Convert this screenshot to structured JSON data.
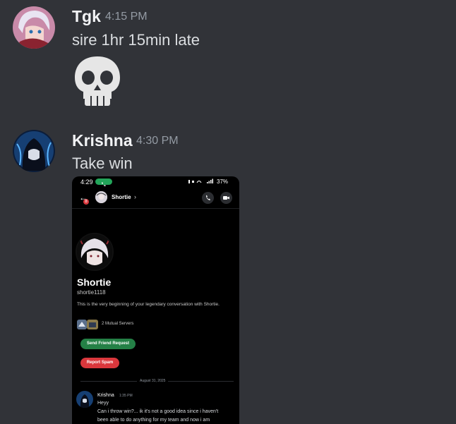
{
  "messages": [
    {
      "author": "Tgk",
      "timestamp": "4:15 PM",
      "lines": [
        "sire 1hr 15min late"
      ],
      "emoji": "💀"
    },
    {
      "author": "Krishna",
      "timestamp": "4:30 PM",
      "lines": [
        "Take win"
      ],
      "attachment": {
        "status_bar": {
          "time": "4:29",
          "battery": "37%"
        },
        "header": {
          "name": "Shortie",
          "notification_count": "8"
        },
        "profile": {
          "display_name": "Shortie",
          "username": "shortie1118",
          "description": "This is the very beginning of your legendary conversation with Shortie.",
          "mutual_servers": "2 Mutual Servers"
        },
        "buttons": {
          "friend_request": "Send Friend Request",
          "report_spam": "Report Spam"
        },
        "date_divider": "August 31, 2025",
        "chat": {
          "author": "Krishna",
          "time": "1:35 PM",
          "lines": [
            "Heyy",
            "Can i throw win?... ik it's not a good idea since i haven't",
            "been able to do anything for my team and now i am"
          ]
        }
      }
    }
  ],
  "colors": {
    "background": "#313338",
    "name": "#f2f3f5",
    "timestamp": "#949ba4",
    "green": "#248046",
    "red": "#da373c"
  }
}
